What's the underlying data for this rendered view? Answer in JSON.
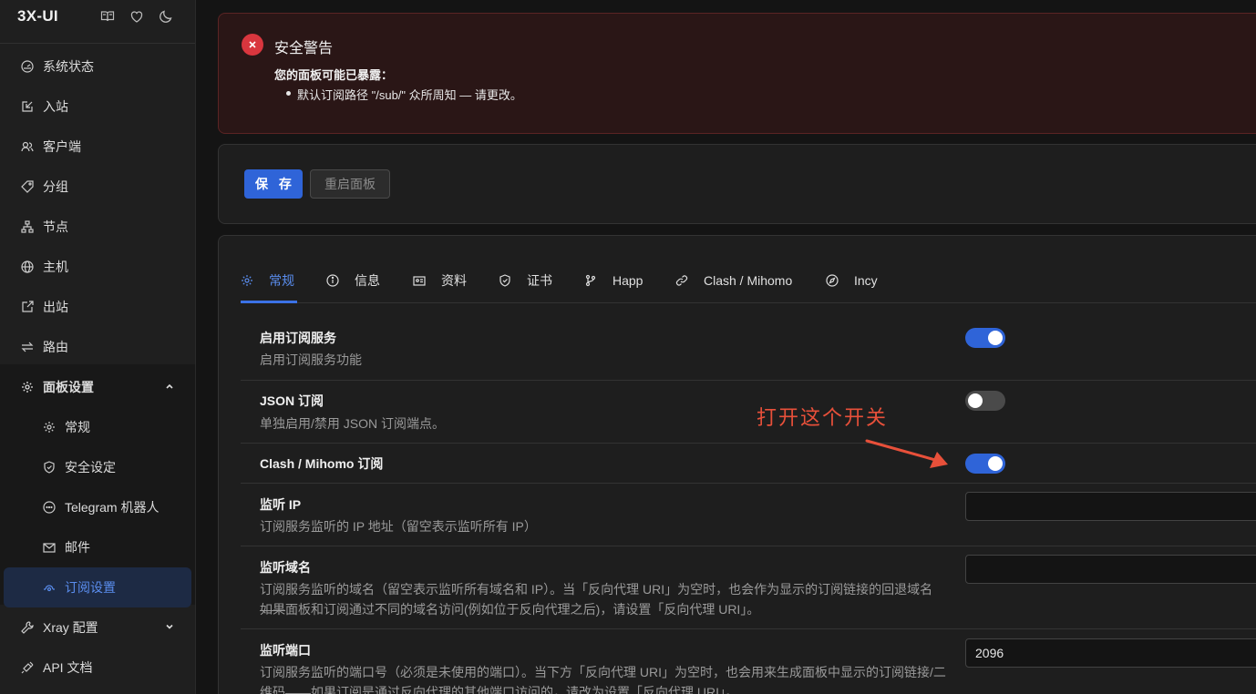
{
  "brand": {
    "title": "3X-UI"
  },
  "brand_icons": [
    "book-icon",
    "heart-icon",
    "moon-icon"
  ],
  "sidebar": {
    "items": [
      {
        "label": "系统状态",
        "icon": "dashboard-icon"
      },
      {
        "label": "入站",
        "icon": "inbound-icon"
      },
      {
        "label": "客户端",
        "icon": "users-icon"
      },
      {
        "label": "分组",
        "icon": "tag-icon"
      },
      {
        "label": "节点",
        "icon": "cluster-icon"
      },
      {
        "label": "主机",
        "icon": "globe-icon"
      },
      {
        "label": "出站",
        "icon": "outbound-icon"
      },
      {
        "label": "路由",
        "icon": "swap-icon"
      },
      {
        "label": "面板设置",
        "icon": "gear-icon",
        "expanded": true
      },
      {
        "label": "常规",
        "icon": "gear-icon",
        "sub": true
      },
      {
        "label": "安全设定",
        "icon": "shield-icon",
        "sub": true
      },
      {
        "label": "Telegram 机器人",
        "icon": "chat-icon",
        "sub": true
      },
      {
        "label": "邮件",
        "icon": "mail-icon",
        "sub": true
      },
      {
        "label": "订阅设置",
        "icon": "subscription-icon",
        "sub": true,
        "active": true
      },
      {
        "label": "Xray 配置",
        "icon": "tool-icon",
        "collapsed": true
      },
      {
        "label": "API 文档",
        "icon": "api-icon"
      }
    ]
  },
  "alert": {
    "title": "安全警告",
    "subtitle": "您的面板可能已暴露：",
    "bullet": "默认订阅路径 \"/sub/\" 众所周知 — 请更改。"
  },
  "actions": {
    "save_label": "保 存",
    "restart_label": "重启面板"
  },
  "tabs": [
    {
      "label": "常规",
      "icon": "gear-icon",
      "active": true
    },
    {
      "label": "信息",
      "icon": "info-icon"
    },
    {
      "label": "资料",
      "icon": "profile-card-icon"
    },
    {
      "label": "证书",
      "icon": "shield-check-icon"
    },
    {
      "label": "Happ",
      "icon": "branch-icon"
    },
    {
      "label": "Clash / Mihomo",
      "icon": "link-icon"
    },
    {
      "label": "Incy",
      "icon": "compass-icon"
    }
  ],
  "settings": {
    "enable_sub": {
      "label": "启用订阅服务",
      "desc": "启用订阅服务功能",
      "on": true
    },
    "json_sub": {
      "label": "JSON 订阅",
      "desc": "单独启用/禁用 JSON 订阅端点。",
      "on": false
    },
    "clash_sub": {
      "label": "Clash / Mihomo 订阅",
      "on": true
    },
    "listen_ip": {
      "label": "监听 IP",
      "desc": "订阅服务监听的 IP 地址（留空表示监听所有 IP）",
      "value": ""
    },
    "listen_domain": {
      "label": "监听域名",
      "desc1": "订阅服务监听的域名（留空表示监听所有域名和 IP）。当「反向代理 URI」为空时，也会作为显示的订阅链接的回退域名——",
      "desc2": "如果面板和订阅通过不同的域名访问(例如位于反向代理之后)，请设置「反向代理 URI」。",
      "value": ""
    },
    "listen_port": {
      "label": "监听端口",
      "desc1": "订阅服务监听的端口号（必须是未使用的端口）。当下方「反向代理 URI」为空时，也会用来生成面板中显示的订阅链接/二",
      "desc2": "维码——如果订阅是通过反向代理的其他端口访问的，请改为设置「反向代理 URI」。",
      "value": "2096"
    }
  },
  "annotation": {
    "text": "打开这个开关",
    "color": "#e8503a"
  },
  "colors": {
    "accent": "#2f64d8",
    "danger": "#d9363e"
  }
}
